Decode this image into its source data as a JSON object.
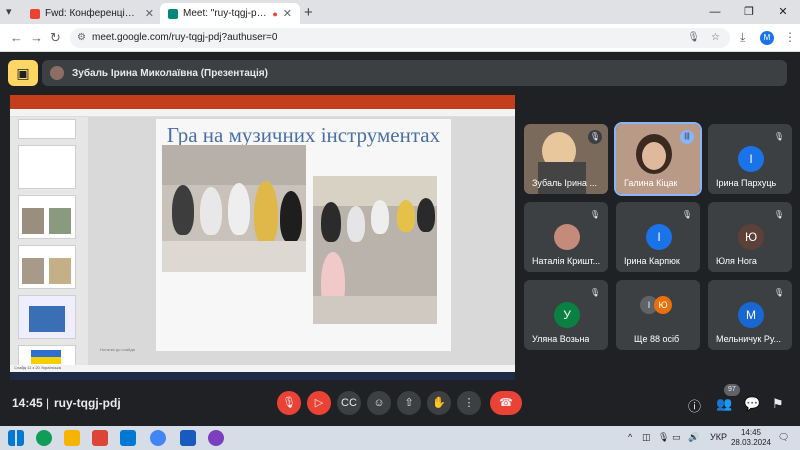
{
  "browser": {
    "tabs": [
      {
        "title": "Fwd: Конференція - nmelnychu",
        "favicon_color": "#ea4335"
      },
      {
        "title": "Meet: \"ruy-tqgj-pdj\"",
        "favicon_color": "#00897b"
      }
    ],
    "url": "meet.google.com/ruy-tqgj-pdj?authuser=0",
    "profile_initial": "M"
  },
  "presentation": {
    "presenter_label": "Зубаль Ірина Миколаївна (Презентація)",
    "slide_title": "Гра на музичних інструментах",
    "notes_placeholder": "Нотатки до слайда",
    "status": "Слайд 11 з 20   Українська"
  },
  "participants": [
    {
      "name": "Зубаль Ірина ...",
      "type": "video",
      "muted": true
    },
    {
      "name": "Галина Кіцак",
      "type": "video",
      "speaking": true
    },
    {
      "name": "Ірина Пархуць",
      "initial": "І",
      "color": "#1a73e8",
      "muted": true
    },
    {
      "name": "Наталія Кришт...",
      "type": "photo",
      "muted": true
    },
    {
      "name": "Ірина Карпюк",
      "initial": "І",
      "color": "#1a73e8",
      "muted": true
    },
    {
      "name": "Юля Нога",
      "initial": "Ю",
      "color": "#5d4037",
      "muted": true
    },
    {
      "name": "Уляна Возьна",
      "initial": "У",
      "color": "#0b8043",
      "muted": true
    },
    {
      "name": "Ще 88 осіб",
      "type": "more",
      "initials": [
        "І",
        "Ю"
      ]
    },
    {
      "name": "Мельничук Ру...",
      "initial": "М",
      "color": "#1967d2",
      "muted": true
    }
  ],
  "meeting": {
    "time": "14:45",
    "code": "ruy-tqgj-pdj",
    "participant_count": "97"
  },
  "taskbar": {
    "lang": "УКР",
    "time": "14:45",
    "date": "28.03.2024"
  }
}
